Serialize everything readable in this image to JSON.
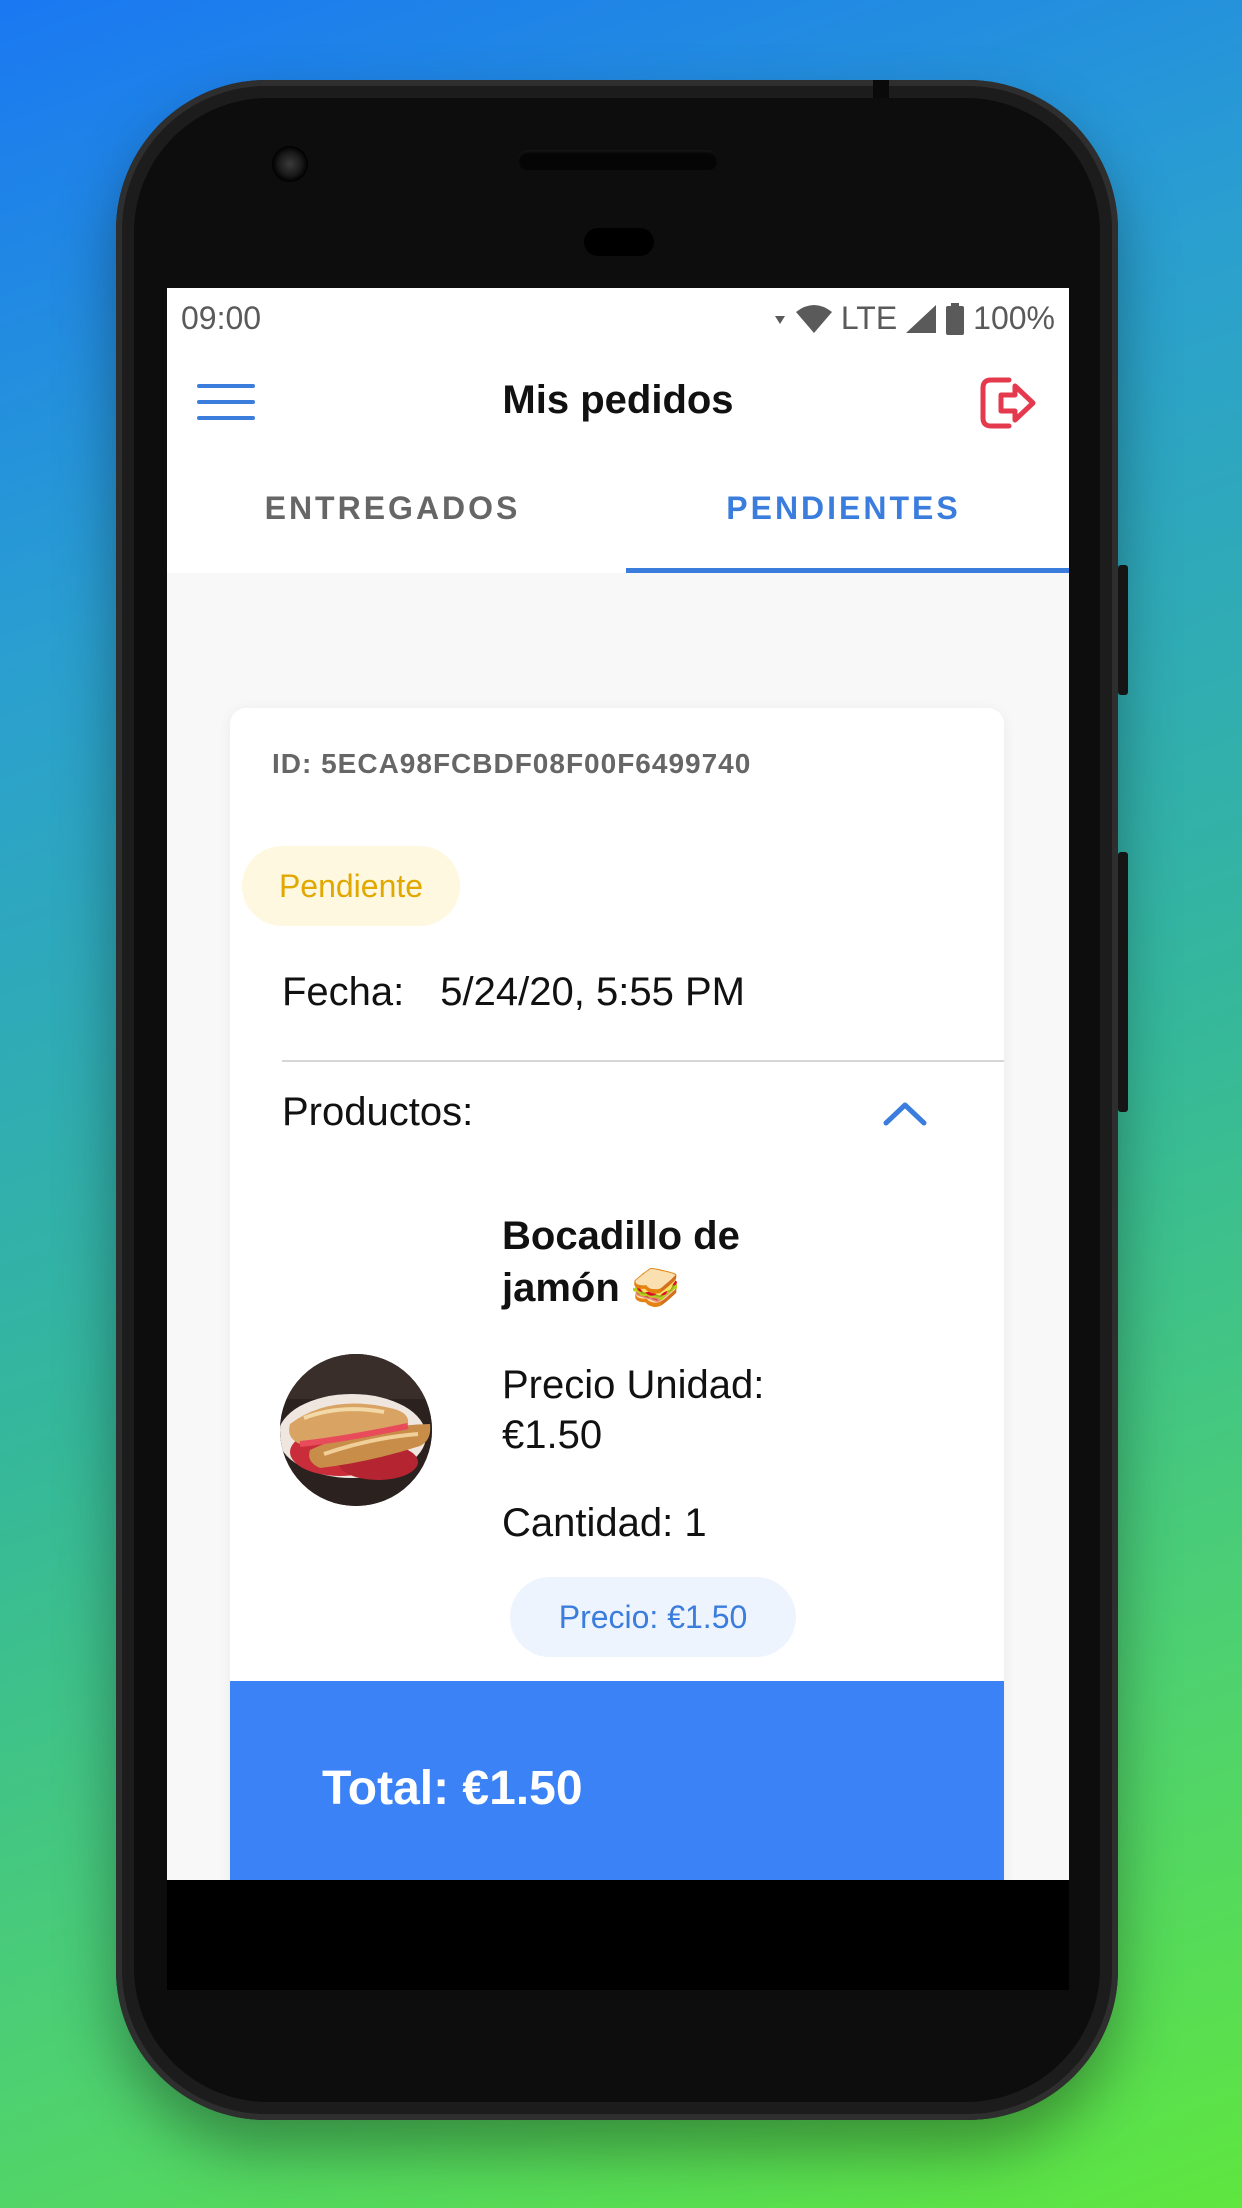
{
  "status_bar": {
    "time": "09:00",
    "network": "LTE",
    "battery": "100%",
    "icons": [
      "wifi-icon",
      "cell-signal-icon",
      "battery-icon"
    ]
  },
  "header": {
    "title": "Mis pedidos",
    "menu_icon": "hamburger-menu-icon",
    "logout_icon": "logout-icon"
  },
  "tabs": [
    {
      "label": "ENTREGADOS",
      "active": false
    },
    {
      "label": "PENDIENTES",
      "active": true
    }
  ],
  "order": {
    "id_text": "ID: 5ECA98FCBDF08F00F6499740",
    "status": "Pendiente",
    "date_label": "Fecha:",
    "date_value": "5/24/20, 5:55 PM",
    "products_label": "Productos:",
    "expanded_icon": "chevron-up-icon",
    "products": [
      {
        "name": "Bocadillo de jamón 🥪",
        "unit_price_label": "Precio Unidad:",
        "unit_price": "€1.50",
        "quantity_text": "Cantidad: 1",
        "price_text": "Precio: €1.50",
        "image": "product-photo"
      }
    ],
    "total_text": "Total: €1.50"
  },
  "colors": {
    "accent": "#3b7ddd",
    "total_bar": "#3b82f6",
    "logout": "#e5394e",
    "pending_text": "#e0a800",
    "pending_bg": "#fff8e0"
  }
}
